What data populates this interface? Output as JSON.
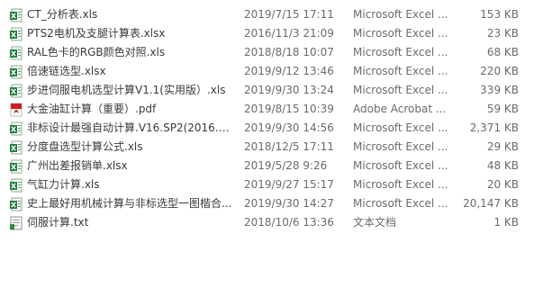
{
  "files": [
    {
      "name": "CT_分析表.xls",
      "date": "2019/7/15 17:11",
      "type": "Microsoft Excel ...",
      "size": "153 KB",
      "icon": "excel-icon"
    },
    {
      "name": "PTS2电机及支腿计算表.xlsx",
      "date": "2016/11/3 21:09",
      "type": "Microsoft Excel ...",
      "size": "23 KB",
      "icon": "excel-icon"
    },
    {
      "name": "RAL色卡的RGB颜色对照.xls",
      "date": "2018/8/18 10:07",
      "type": "Microsoft Excel ...",
      "size": "68 KB",
      "icon": "excel-icon"
    },
    {
      "name": "倍速链选型.xlsx",
      "date": "2019/9/12 13:46",
      "type": "Microsoft Excel ...",
      "size": "220 KB",
      "icon": "excel-icon"
    },
    {
      "name": "步进伺服电机选型计算V1.1(实用版）.xls",
      "date": "2019/9/30 13:24",
      "type": "Microsoft Excel ...",
      "size": "339 KB",
      "icon": "excel-icon"
    },
    {
      "name": "大金油缸计算（重要）.pdf",
      "date": "2019/8/15 10:39",
      "type": "Adobe Acrobat ...",
      "size": "59 KB",
      "icon": "pdf-icon"
    },
    {
      "name": "非标设计最强自动计算.V16.SP2(2016.0...",
      "date": "2019/9/30 14:56",
      "type": "Microsoft Excel ...",
      "size": "2,371 KB",
      "icon": "excel-icon"
    },
    {
      "name": "分度盘选型计算公式.xls",
      "date": "2018/12/5 17:11",
      "type": "Microsoft Excel ...",
      "size": "29 KB",
      "icon": "excel-icon"
    },
    {
      "name": "广州出差报销单.xlsx",
      "date": "2019/5/28 9:26",
      "type": "Microsoft Excel ...",
      "size": "48 KB",
      "icon": "excel-icon"
    },
    {
      "name": "气缸力计算.xls",
      "date": "2019/9/27 15:17",
      "type": "Microsoft Excel ...",
      "size": "20 KB",
      "icon": "excel-icon"
    },
    {
      "name": "史上最好用机械计算与非标选型一图楷合...",
      "date": "2019/9/30 14:27",
      "type": "Microsoft Excel ...",
      "size": "20,147 KB",
      "icon": "excel-icon"
    },
    {
      "name": "伺服计算.txt",
      "date": "2018/10/6 13:36",
      "type": "文本文档",
      "size": "1 KB",
      "icon": "text-file-icon"
    }
  ],
  "colors": {
    "excel_green": "#1f7a3a",
    "pdf_red": "#c8201c",
    "text_gray": "#6b6b6b"
  }
}
